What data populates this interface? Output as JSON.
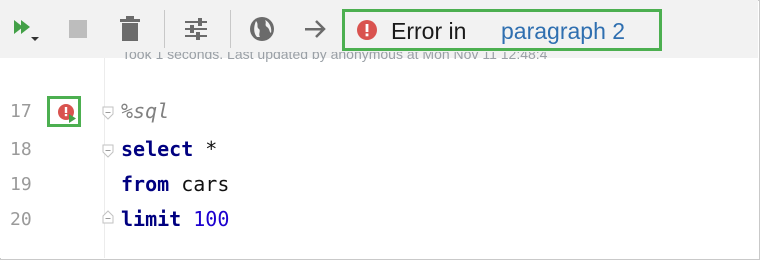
{
  "toolbar": {
    "run_all_icon": "run-all-icon",
    "stop_icon": "stop-icon",
    "delete_icon": "trash-icon",
    "settings_icon": "settings-sliders-icon",
    "web_icon": "globe-icon",
    "navigate_icon": "arrow-right-icon",
    "error_status": {
      "label": "Error in",
      "link": "paragraph 2",
      "icon": "error-icon"
    }
  },
  "status_text": "Took 1 seconds. Last updated by anonymous at Mon Nov 11 12:48:4",
  "editor": {
    "lines": [
      {
        "number": "17",
        "tokens": [
          {
            "text": "%sql",
            "type": "magic"
          }
        ]
      },
      {
        "number": "18",
        "tokens": [
          {
            "text": "select",
            "type": "keyword"
          },
          {
            "text": " *",
            "type": "plain"
          }
        ]
      },
      {
        "number": "19",
        "tokens": [
          {
            "text": "from",
            "type": "keyword"
          },
          {
            "text": " cars",
            "type": "plain"
          }
        ]
      },
      {
        "number": "20",
        "tokens": [
          {
            "text": "limit",
            "type": "keyword"
          },
          {
            "text": " 100",
            "type": "number"
          }
        ]
      }
    ],
    "gutter_marker_icon": "error-run-icon"
  },
  "colors": {
    "highlight_border": "#4caf50",
    "error_red": "#d9534f",
    "link_blue": "#2f6fb0",
    "run_green": "#43a047",
    "keyword_navy": "#000080",
    "number_blue": "#1c00cf"
  }
}
